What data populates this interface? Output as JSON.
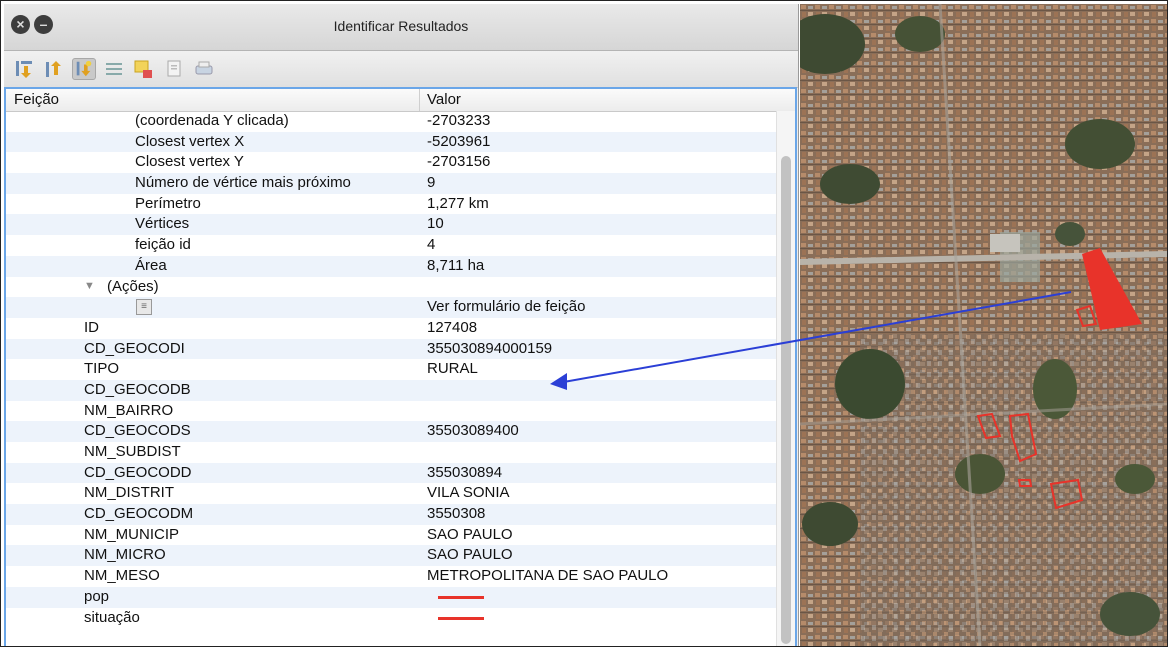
{
  "window": {
    "title": "Identificar Resultados"
  },
  "toolbar": {
    "buttons": [
      {
        "name": "expand-tree-icon"
      },
      {
        "name": "collapse-tree-icon"
      },
      {
        "name": "expand-new-results-icon"
      },
      {
        "name": "open-form-icon"
      },
      {
        "name": "highlight-features-icon"
      },
      {
        "name": "copy-feature-icon"
      },
      {
        "name": "print-icon"
      }
    ]
  },
  "table": {
    "col_feature": "Feição",
    "col_value": "Valor",
    "rows": [
      {
        "key": "(coordenada Y clicada)",
        "value": "-2703233"
      },
      {
        "key": "Closest vertex X",
        "value": "-5203961"
      },
      {
        "key": "Closest vertex Y",
        "value": "-2703156"
      },
      {
        "key": "Número de vértice mais próximo",
        "value": "9"
      },
      {
        "key": "Perímetro",
        "value": "1,277 km"
      },
      {
        "key": "Vértices",
        "value": "10"
      },
      {
        "key": "feição id",
        "value": "4"
      },
      {
        "key": "Área",
        "value": "8,711 ha"
      },
      {
        "key": "(Ações)",
        "value": ""
      },
      {
        "key": "",
        "value": "Ver formulário de feição"
      },
      {
        "key": "ID",
        "value": "127408"
      },
      {
        "key": "CD_GEOCODI",
        "value": "355030894000159"
      },
      {
        "key": "TIPO",
        "value": "RURAL"
      },
      {
        "key": "CD_GEOCODB",
        "value": ""
      },
      {
        "key": "NM_BAIRRO",
        "value": ""
      },
      {
        "key": "CD_GEOCODS",
        "value": "35503089400"
      },
      {
        "key": "NM_SUBDIST",
        "value": ""
      },
      {
        "key": "CD_GEOCODD",
        "value": "355030894"
      },
      {
        "key": "NM_DISTRIT",
        "value": "VILA SONIA"
      },
      {
        "key": "CD_GEOCODM",
        "value": "3550308"
      },
      {
        "key": "NM_MUNICIP",
        "value": "SAO PAULO"
      },
      {
        "key": "NM_MICRO",
        "value": "SAO PAULO"
      },
      {
        "key": "NM_MESO",
        "value": "METROPOLITANA DE SAO PAULO"
      },
      {
        "key": "pop",
        "value": ""
      },
      {
        "key": "situação",
        "value": ""
      }
    ]
  },
  "colors": {
    "accent_border": "#6aa6e8",
    "row_alt": "#edf3fb",
    "polygon_red": "#e8332a",
    "arrow_blue": "#2b3fd6"
  }
}
